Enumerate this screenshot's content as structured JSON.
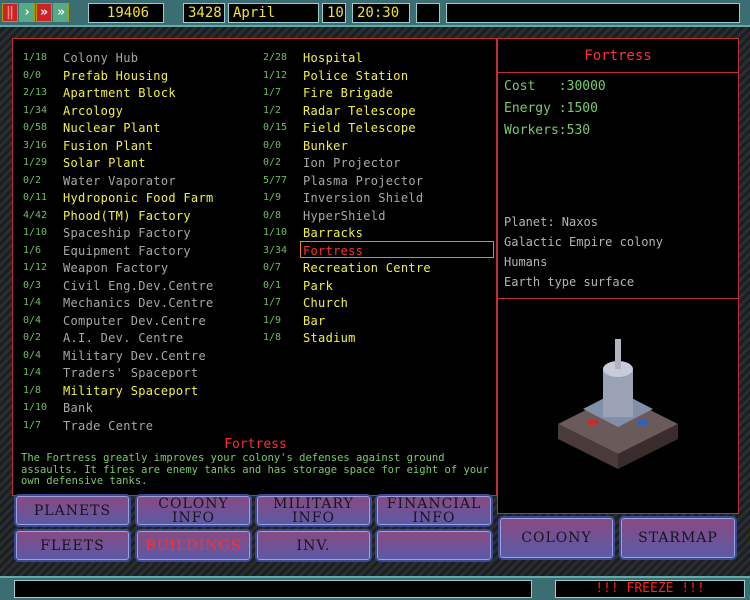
{
  "topbar": {
    "credits": "19406",
    "year": "3428",
    "month": "April",
    "day": "10",
    "time": "20:30",
    "pause_icon": "pause-icon",
    "play_icon": "play-icon",
    "fast_icon": "fast-forward-icon",
    "faster_icon": "fastest-icon"
  },
  "buildings_left": [
    {
      "count": "1/18",
      "name": "Colony Hub",
      "status": "unavailable"
    },
    {
      "count": "0/0",
      "name": "Prefab Housing",
      "status": "available"
    },
    {
      "count": "2/13",
      "name": "Apartment Block",
      "status": "available"
    },
    {
      "count": "1/34",
      "name": "Arcology",
      "status": "available"
    },
    {
      "count": "0/58",
      "name": "Nuclear Plant",
      "status": "available"
    },
    {
      "count": "3/16",
      "name": "Fusion Plant",
      "status": "available"
    },
    {
      "count": "1/29",
      "name": "Solar Plant",
      "status": "available"
    },
    {
      "count": "0/2",
      "name": "Water Vaporator",
      "status": "unavailable"
    },
    {
      "count": "0/11",
      "name": "Hydroponic Food Farm",
      "status": "available"
    },
    {
      "count": "4/42",
      "name": "Phood(TM) Factory",
      "status": "available"
    },
    {
      "count": "1/10",
      "name": "Spaceship Factory",
      "status": "unavailable"
    },
    {
      "count": "1/6",
      "name": "Equipment Factory",
      "status": "unavailable"
    },
    {
      "count": "1/12",
      "name": "Weapon Factory",
      "status": "unavailable"
    },
    {
      "count": "0/3",
      "name": "Civil Eng.Dev.Centre",
      "status": "unavailable"
    },
    {
      "count": "1/4",
      "name": "Mechanics Dev.Centre",
      "status": "unavailable"
    },
    {
      "count": "0/4",
      "name": "Computer Dev.Centre",
      "status": "unavailable"
    },
    {
      "count": "0/2",
      "name": "A.I. Dev. Centre",
      "status": "unavailable"
    },
    {
      "count": "0/4",
      "name": "Military Dev.Centre",
      "status": "unavailable"
    },
    {
      "count": "1/4",
      "name": "Traders' Spaceport",
      "status": "unavailable"
    },
    {
      "count": "1/8",
      "name": "Military Spaceport",
      "status": "available"
    },
    {
      "count": "1/10",
      "name": "Bank",
      "status": "unavailable"
    },
    {
      "count": "1/7",
      "name": "Trade Centre",
      "status": "unavailable"
    }
  ],
  "buildings_right": [
    {
      "count": "2/28",
      "name": "Hospital",
      "status": "available"
    },
    {
      "count": "1/12",
      "name": "Police Station",
      "status": "available"
    },
    {
      "count": "1/7",
      "name": "Fire Brigade",
      "status": "available"
    },
    {
      "count": "1/2",
      "name": "Radar Telescope",
      "status": "available"
    },
    {
      "count": "0/15",
      "name": "Field Telescope",
      "status": "available"
    },
    {
      "count": "0/0",
      "name": "Bunker",
      "status": "available"
    },
    {
      "count": "0/2",
      "name": "Ion Projector",
      "status": "unavailable"
    },
    {
      "count": "5/77",
      "name": "Plasma Projector",
      "status": "unavailable"
    },
    {
      "count": "1/9",
      "name": "Inversion Shield",
      "status": "unavailable"
    },
    {
      "count": "0/8",
      "name": "HyperShield",
      "status": "unavailable"
    },
    {
      "count": "1/10",
      "name": "Barracks",
      "status": "available"
    },
    {
      "count": "3/34",
      "name": "Fortress",
      "status": "selected"
    },
    {
      "count": "0/7",
      "name": "Recreation Centre",
      "status": "available"
    },
    {
      "count": "0/1",
      "name": "Park",
      "status": "available"
    },
    {
      "count": "1/7",
      "name": "Church",
      "status": "available"
    },
    {
      "count": "1/9",
      "name": "Bar",
      "status": "available"
    },
    {
      "count": "1/8",
      "name": "Stadium",
      "status": "available"
    }
  ],
  "description": {
    "title": "Fortress",
    "text": "The Fortress greatly improves your colony's defenses against ground assaults. It fires are enemy tanks and has storage space for eight of your own defensive tanks."
  },
  "details": {
    "title": "Fortress",
    "cost_label": "Cost   :",
    "cost": "30000",
    "energy_label": "Energy :",
    "energy": "1500",
    "workers_label": "Workers:",
    "workers": "530",
    "planet": "Planet: Naxos",
    "owner": "Galactic Empire colony",
    "race": "Humans",
    "surface": "Earth type surface"
  },
  "nav": {
    "planets": "PLANETS",
    "colony_info": "COLONY INFO",
    "military_info": "MILITARY INFO",
    "financial_info": "FINANCIAL INFO",
    "fleets": "FLEETS",
    "buildings": "BUILDINGS",
    "inv": "INV.",
    "colony": "COLONY",
    "starmap": "STARMAP"
  },
  "status": {
    "message": "!!! FREEZE !!!"
  },
  "colors": {
    "available": "#f4f040",
    "unavailable": "#a8a8a8",
    "selected": "#ff3030",
    "count": "#6cc060",
    "active_tab": "#ff3030"
  }
}
